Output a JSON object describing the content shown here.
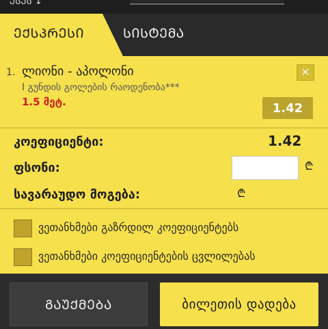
{
  "colors": {
    "accent": "#f6e04c",
    "odd_red": "#cf1d1d",
    "dark": "#2c2c2c"
  },
  "topbar": {
    "cropped_text": "ᲔᲡᲔᲡ ↓"
  },
  "tabs": [
    {
      "label": "ᲔᲥᲡᲞᲠᲔᲡᲘ"
    },
    {
      "label": "ᲡᲘᲡᲢᲔᲛᲐ"
    }
  ],
  "bet": {
    "number": "1.",
    "match": "ლიონი - აპოლონი",
    "market": "I გუნდის გოლების რაოდენობა***",
    "selection": "1.5 მეტ.",
    "odd": "1.42"
  },
  "summary": {
    "coef_label": "კოეფიციენტი:",
    "coef_value": "1.42",
    "stake_label": "ფსონი:",
    "stake_value": "",
    "win_label": "სავარაუდო მოგება:",
    "currency": "₾"
  },
  "options": [
    {
      "label": "ვეთანხმები გაზრდილ კოეფიციენტებს"
    },
    {
      "label": "ვეთანხმები კოეფიციენტების ცვლილებას"
    }
  ],
  "buttons": {
    "cancel": "ᲒᲐᲣᲥᲛᲔᲑᲐ",
    "place": "ბილეთის დადება"
  }
}
